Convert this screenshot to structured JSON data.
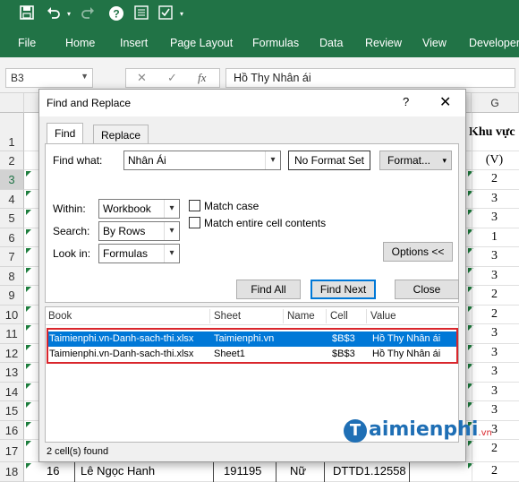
{
  "ribbon": {
    "tabs": [
      "File",
      "Home",
      "Insert",
      "Page Layout",
      "Formulas",
      "Data",
      "Review",
      "View",
      "Developer"
    ],
    "icons": [
      "save-icon",
      "undo-icon",
      "redo-icon",
      "help-icon",
      "form-icon",
      "customize-icon"
    ]
  },
  "formula_bar": {
    "name_box": "B3",
    "formula": "Hồ Thy Nhân ái",
    "fx": "fx",
    "cancel": "✕",
    "enter": "✓"
  },
  "grid": {
    "column_g": "G",
    "row_numbers": [
      "1",
      "2",
      "3",
      "4",
      "5",
      "6",
      "7",
      "8",
      "9",
      "10",
      "11",
      "12",
      "13",
      "14",
      "15",
      "16",
      "17",
      "18"
    ],
    "g_values": [
      "Khu vực",
      "(V)",
      "2",
      "3",
      "3",
      "1",
      "3",
      "3",
      "2",
      "2",
      "3",
      "3",
      "3",
      "3",
      "3",
      "3",
      "2",
      "2"
    ],
    "row18": {
      "stt": "16",
      "name": "Lê Ngọc Hanh",
      "id": "191195",
      "gender": "Nữ",
      "class": "DTTD1.12558"
    }
  },
  "dialog": {
    "title": "Find and Replace",
    "help": "?",
    "close": "✕",
    "tabs": [
      "Find",
      "Replace"
    ],
    "find_what_label": "Find what:",
    "find_what_value": "Nhân Ái",
    "no_format": "No Format Set",
    "format_button": "Format...",
    "within_label": "Within:",
    "within_value": "Workbook",
    "search_label": "Search:",
    "search_value": "By Rows",
    "lookin_label": "Look in:",
    "lookin_value": "Formulas",
    "match_case": "Match case",
    "match_entire": "Match entire cell contents",
    "options_button": "Options <<",
    "find_all": "Find All",
    "find_next": "Find Next",
    "close_button": "Close",
    "results": {
      "columns": [
        "Book",
        "Sheet",
        "Name",
        "Cell",
        "Value"
      ],
      "rows": [
        {
          "book": "Taimienphi.vn-Danh-sach-thi.xlsx",
          "sheet": "Taimienphi.vn",
          "name": "",
          "cell": "$B$3",
          "value": "Hồ Thy Nhân ái"
        },
        {
          "book": "Taimienphi.vn-Danh-sach-thi.xlsx",
          "sheet": "Sheet1",
          "name": "",
          "cell": "$B$3",
          "value": "Hồ Thy Nhân ái"
        }
      ]
    },
    "status": "2 cell(s) found"
  },
  "watermark": {
    "main": "aimienphi",
    "suffix": ".vn",
    "initial": "T"
  },
  "colors": {
    "excel_green": "#217346",
    "selection": "#0078d7",
    "highlight_box": "#d9262c"
  }
}
